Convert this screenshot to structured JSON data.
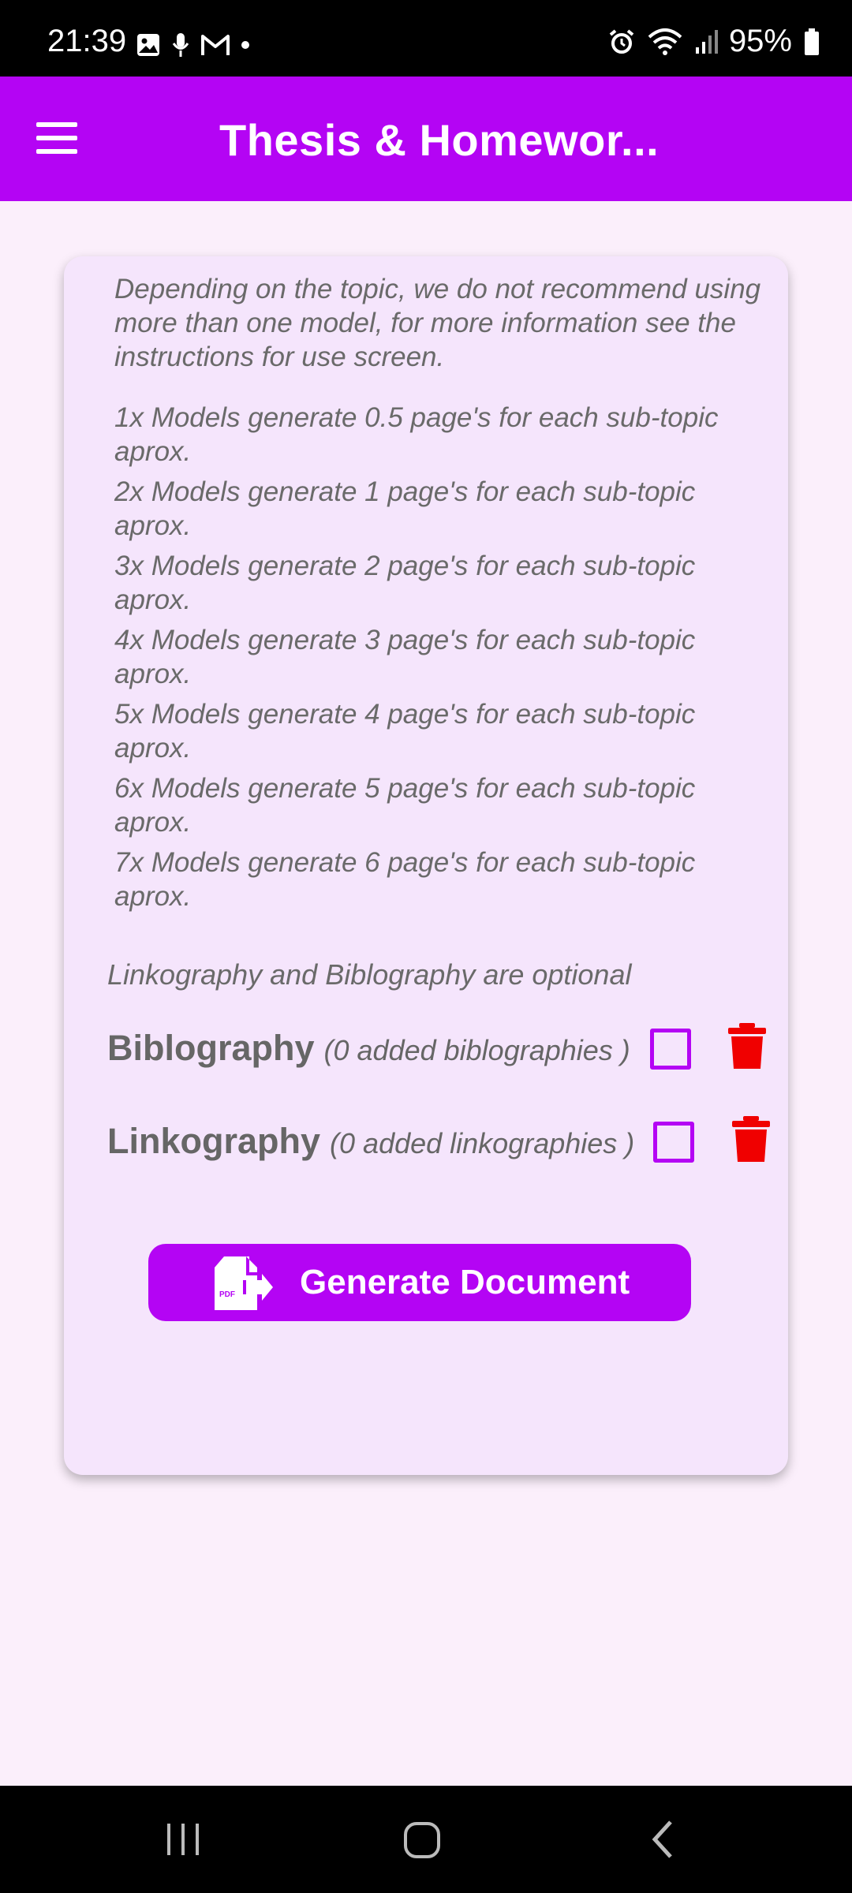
{
  "status_bar": {
    "time": "21:39",
    "battery": "95%",
    "icons": [
      "gallery-icon",
      "mic-icon",
      "gmail-icon",
      "dot-icon",
      "alarm-icon",
      "wifi-icon",
      "signal-icon",
      "battery-icon"
    ]
  },
  "toolbar": {
    "title": "Thesis & Homewor...",
    "menu_icon": "hamburger-menu-icon",
    "color": "#b404f4"
  },
  "info": {
    "text": "Depending on the topic, we do not recommend using more than one model, for more information see the instructions for use screen."
  },
  "models": [
    {
      "text": "1x  Models generate 0.5 page's for each sub-topic aprox."
    },
    {
      "text": "2x  Models generate 1 page's for each sub-topic aprox."
    },
    {
      "text": "3x  Models generate 2 page's for each sub-topic aprox."
    },
    {
      "text": "4x  Models generate 3 page's for each sub-topic aprox."
    },
    {
      "text": "5x  Models generate 4 page's for each sub-topic aprox."
    },
    {
      "text": "6x  Models generate 5 page's for each sub-topic aprox."
    },
    {
      "text": "7x  Models generate 6 page's for each sub-topic aprox."
    }
  ],
  "optional_note": "Linkography and Biblography are optional",
  "biblography": {
    "label": "Biblography",
    "count_text": "(0 added biblographies )",
    "checked": false
  },
  "linkography": {
    "label": "Linkography",
    "count_text": "(0 added linkographies )",
    "checked": false
  },
  "generate_button": {
    "label": "Generate Document",
    "icon": "pdf-export-icon",
    "icon_text": "PDF"
  },
  "colors": {
    "accent": "#b404f4",
    "delete": "#f00000",
    "background": "#fbeffb",
    "card": "#f5e5fc"
  }
}
